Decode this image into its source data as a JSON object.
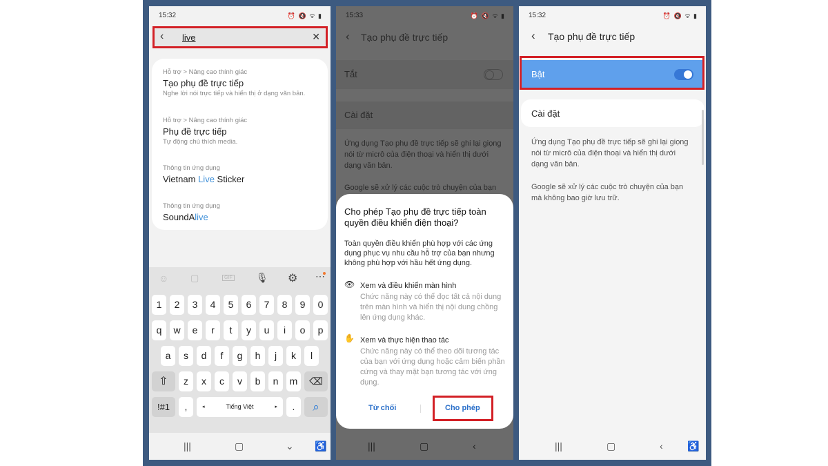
{
  "colors": {
    "accent": "#3e8fd8",
    "highlight_box": "#d32026",
    "toggle_on": "#5fa0ec"
  },
  "screen1": {
    "status_time": "15:32",
    "status_icons": "⏰ 🔇 ᯤ ▮",
    "search_value": "live",
    "results": [
      {
        "category": "Hỗ trợ > Nâng cao thính giác",
        "title": "Tạo phụ đề trực tiếp",
        "desc": "Nghe lời nói trực tiếp và hiển thị ở dạng văn bản."
      },
      {
        "category": "Hỗ trợ > Nâng cao thính giác",
        "title": "Phụ đề trực tiếp",
        "desc": "Tự động chú thích media."
      },
      {
        "category": "Thông tin ứng dụng",
        "title_pre": "Vietnam ",
        "title_hl": "Live",
        "title_post": " Sticker"
      },
      {
        "category": "Thông tin ứng dụng",
        "title_pre": "SoundA",
        "title_hl": "live",
        "title_post": ""
      }
    ],
    "keyboard": {
      "row_numbers": [
        "1",
        "2",
        "3",
        "4",
        "5",
        "6",
        "7",
        "8",
        "9",
        "0"
      ],
      "row1": [
        "q",
        "w",
        "e",
        "r",
        "t",
        "y",
        "u",
        "i",
        "o",
        "p"
      ],
      "row2": [
        "a",
        "s",
        "d",
        "f",
        "g",
        "h",
        "j",
        "k",
        "l"
      ],
      "row3": [
        "z",
        "x",
        "c",
        "v",
        "b",
        "n",
        "m"
      ],
      "symbols_key": "!#1",
      "comma_key": ",",
      "space_label": "Tiếng Việt",
      "period_key": "."
    }
  },
  "screen2": {
    "status_time": "15:33",
    "status_icons": "⏰ 🔇 ᯤ ▮",
    "title": "Tạo phụ đề trực tiếp",
    "toggle_label": "Tắt",
    "settings_label": "Cài đặt",
    "description": "Ứng dụng Tạo phụ đề trực tiếp sẽ ghi lại giọng nói từ micrô của điện thoại và hiển thị dưới dạng văn bản.",
    "google_note": "Google sẽ xử lý các cuộc trò chuyện của bạn",
    "dialog": {
      "title": "Cho phép Tạo phụ đề trực tiếp toàn quyền điều khiển điện thoại?",
      "body": "Toàn quyền điều khiển phù hợp với các ứng dụng phục vụ nhu cầu hỗ trợ của bạn nhưng không phù hợp với hầu hết ứng dụng.",
      "perm1_title": "Xem và điều khiển màn hình",
      "perm1_desc": "Chức năng này có thể đọc tất cả nội dung trên màn hình và hiển thị nội dung chồng lên ứng dụng khác.",
      "perm2_title": "Xem và thực hiện thao tác",
      "perm2_desc": "Chức năng này có thể theo dõi tương tác của bạn với ứng dụng hoặc cảm biến phần cứng và thay mặt bạn tương tác với ứng dụng.",
      "deny_label": "Từ chối",
      "allow_label": "Cho phép"
    }
  },
  "screen3": {
    "status_time": "15:32",
    "status_icons": "⏰ 🔇 ᯤ ▮",
    "title": "Tạo phụ đề trực tiếp",
    "toggle_label": "Bật",
    "settings_label": "Cài đặt",
    "description": "Ứng dụng Tạo phụ đề trực tiếp sẽ ghi lại giọng nói từ micrô của điện thoại và hiển thị dưới dạng văn bản.",
    "google_note": "Google sẽ xử lý các cuộc trò chuyện của bạn mà không bao giờ lưu trữ."
  }
}
